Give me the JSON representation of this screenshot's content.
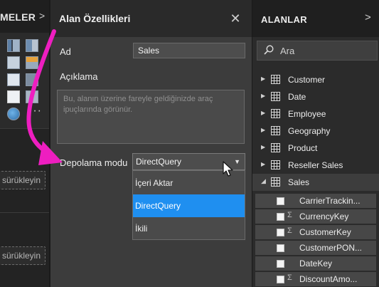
{
  "left_pane": {
    "title": "MELER",
    "drop_hint_1": "sürükleyin",
    "drop_hint_2": "sürükleyin"
  },
  "properties": {
    "title": "Alan Özellikleri",
    "name_label": "Ad",
    "name_value": "Sales",
    "description_label": "Açıklama",
    "description_placeholder": "Bu, alanın üzerine fareyle geldiğinizde araç ipuçlarında görünür.",
    "storage_label": "Depolama modu",
    "storage_selected": "DirectQuery",
    "storage_options": [
      "İçeri Aktar",
      "DirectQuery",
      "İkili"
    ]
  },
  "fields": {
    "title": "ALANLAR",
    "search_placeholder": "Ara",
    "tables": [
      "Customer",
      "Date",
      "Employee",
      "Geography",
      "Product",
      "Reseller Sales",
      "Sales"
    ],
    "sales_fields": [
      {
        "name": "CarrierTrackin...",
        "sigma": false
      },
      {
        "name": "CurrencyKey",
        "sigma": true
      },
      {
        "name": "CustomerKey",
        "sigma": true
      },
      {
        "name": "CustomerPON...",
        "sigma": false
      },
      {
        "name": "DateKey",
        "sigma": false
      },
      {
        "name": "DiscountAmo...",
        "sigma": true
      }
    ]
  },
  "colors": {
    "accent": "#1f8ff0",
    "annotation": "#ee1ec0"
  }
}
